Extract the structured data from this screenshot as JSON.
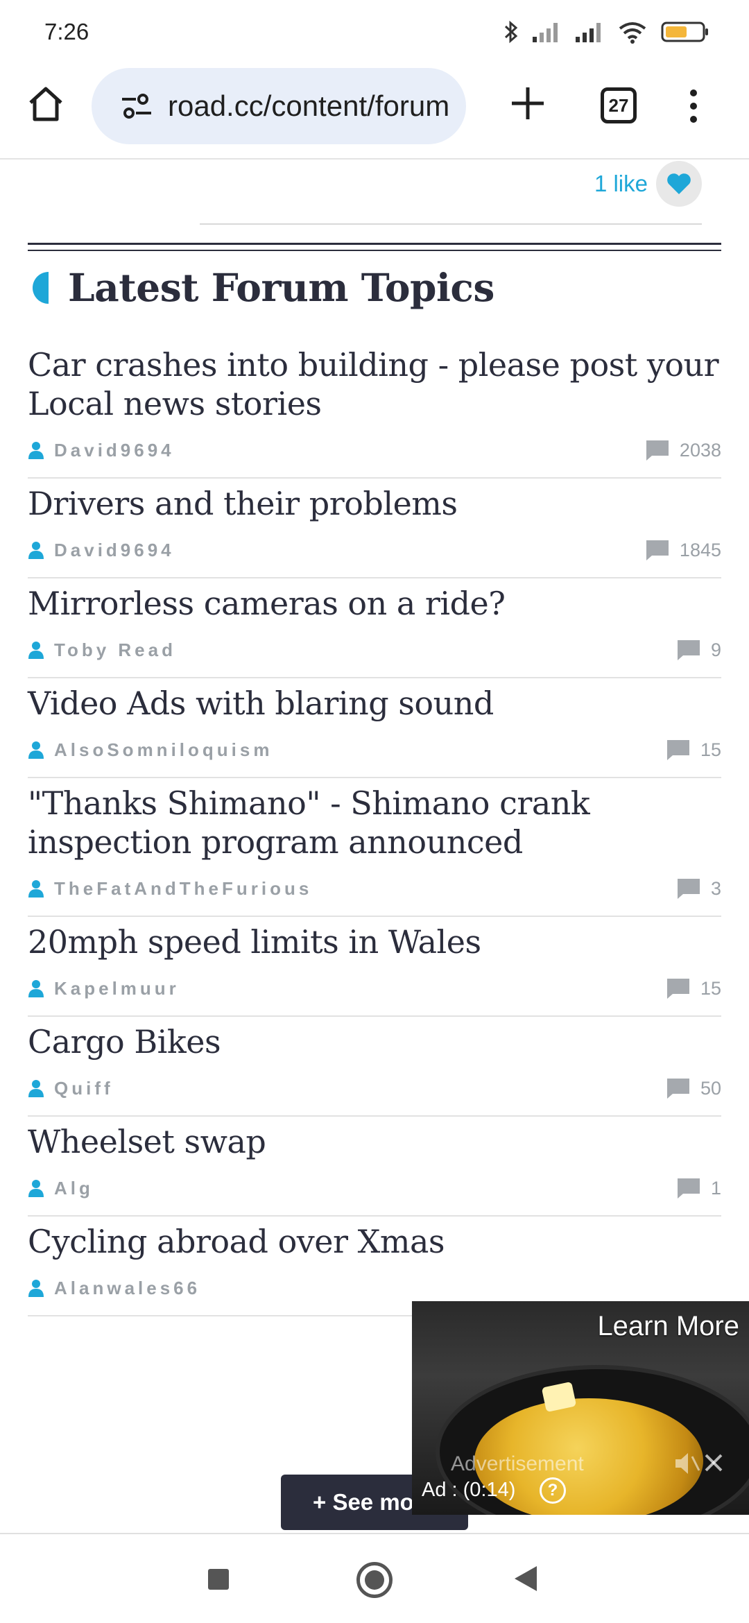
{
  "status_bar": {
    "time": "7:26"
  },
  "browser": {
    "url": "road.cc/content/forum",
    "tab_count": "27"
  },
  "like": {
    "label": "1 like"
  },
  "section": {
    "title": "Latest Forum Topics"
  },
  "topics": [
    {
      "title": "Car crashes into building - please post your Local news stories",
      "author": "David9694",
      "replies": "2038"
    },
    {
      "title": "Drivers and their problems",
      "author": "David9694",
      "replies": "1845"
    },
    {
      "title": "Mirrorless cameras on a ride?",
      "author": "Toby Read",
      "replies": "9"
    },
    {
      "title": "Video Ads with blaring sound",
      "author": "AlsoSomniloquism",
      "replies": "15"
    },
    {
      "title": "\"Thanks Shimano\" - Shimano crank inspection program announced",
      "author": "TheFatAndTheFurious",
      "replies": "3"
    },
    {
      "title": "20mph speed limits in Wales",
      "author": "Kapelmuur",
      "replies": "15"
    },
    {
      "title": "Cargo Bikes",
      "author": "Quiff",
      "replies": "50"
    },
    {
      "title": "Wheelset swap",
      "author": "Alg",
      "replies": "1"
    },
    {
      "title": "Cycling abroad over Xmas",
      "author": "Alanwales66",
      "replies": ""
    }
  ],
  "see_more": {
    "label": "+ See more"
  },
  "ad": {
    "learn_more": "Learn More",
    "label": "Advertisement",
    "timer": "Ad : (0:14)",
    "help": "?"
  },
  "colors": {
    "accent": "#1ea7d8",
    "heading": "#2b2d3c",
    "meta": "#9aa0a6"
  }
}
